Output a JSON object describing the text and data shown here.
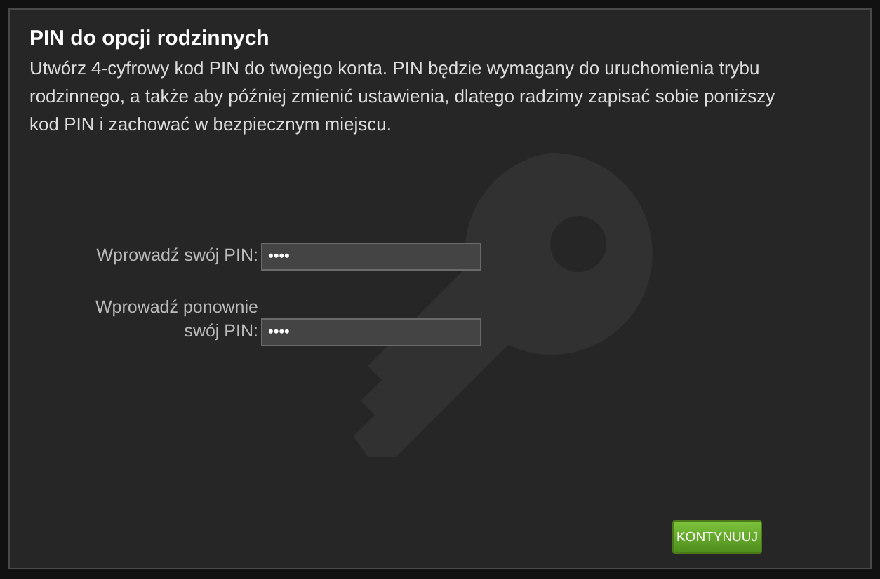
{
  "dialog": {
    "title": "PIN do opcji rodzinnych",
    "description": "Utwórz 4-cyfrowy kod PIN do twojego konta. PIN będzie wymagany do uruchomienia trybu rodzinnego, a także aby później zmienić ustawienia, dlatego radzimy zapisać sobie poniższy kod PIN i zachować w bezpiecznym miejscu.",
    "fields": [
      {
        "label": "Wprowadź swój PIN:",
        "value": "••••"
      },
      {
        "label": "Wprowadź ponownie swój PIN:",
        "value": "••••"
      }
    ],
    "button": "KONTYNUUJ"
  }
}
